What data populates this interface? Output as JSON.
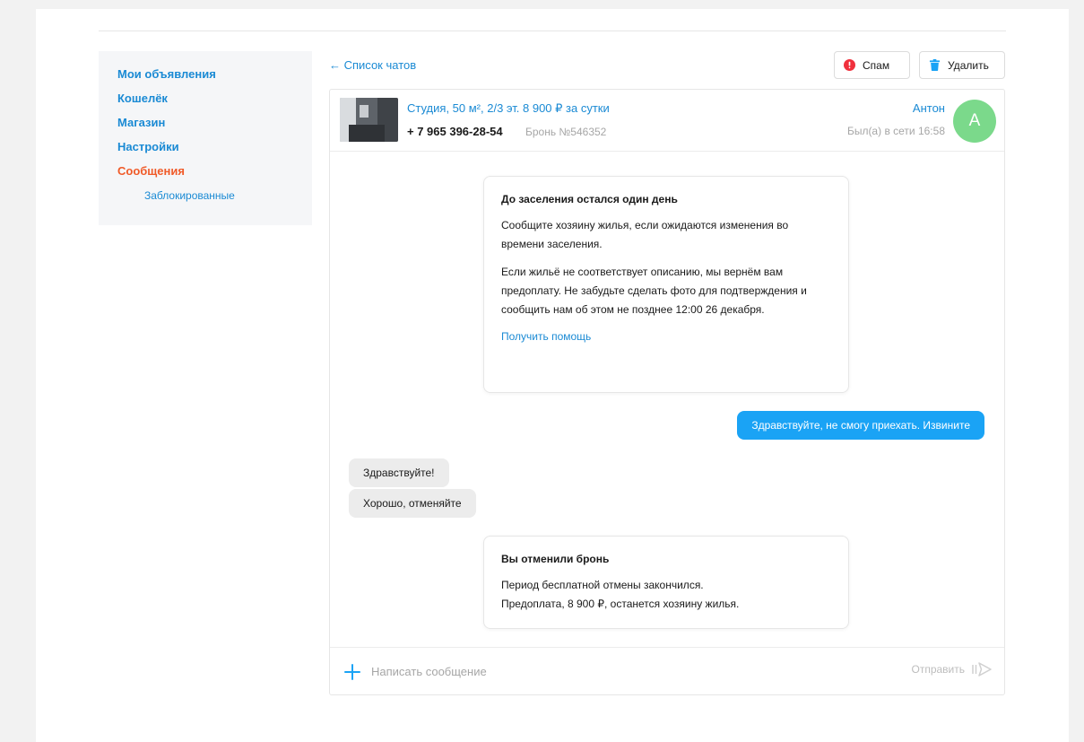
{
  "sidebar": {
    "items": [
      {
        "label": "Мои объявления"
      },
      {
        "label": "Кошелёк"
      },
      {
        "label": "Магазин"
      },
      {
        "label": "Настройки"
      },
      {
        "label": "Сообщения"
      }
    ],
    "sub_label": "Заблокированные"
  },
  "toolbar": {
    "back_label": "← Список чатов",
    "spam_label": "Спам",
    "delete_label": "Удалить"
  },
  "chat": {
    "listing_title": "Студия, 50 м², 2/3 эт.  8 900 ₽ за сутки",
    "phone": "+ 7 965 396-28-54",
    "booking": "Бронь №546352",
    "user_name": "Антон",
    "user_status": "Был(а) в сети 16:58",
    "avatar_letter": "А"
  },
  "messages": {
    "card1": {
      "title": "До заселения остался один день",
      "p1": "Сообщите хозяину жилья, если ожидаются изменения во времени заселения.",
      "p2": "Если жильё не соответствует описанию, мы вернём вам предоплату. Не забудьте сделать фото для подтверждения и сообщить нам об этом не позднее 12:00 26 декабря.",
      "help": "Получить помощь"
    },
    "outgoing": "Здравствуйте, не смогу приехать. Извините",
    "incoming": [
      "Здравствуйте!",
      "Хорошо, отменяйте"
    ],
    "card2": {
      "title": "Вы отменили бронь",
      "p1": "Период бесплатной отмены закончился.",
      "p2": "Предоплата, 8 900 ₽, останется хозяину жилья."
    }
  },
  "composer": {
    "placeholder": "Написать сообщение",
    "send_label": "Отправить"
  },
  "colors": {
    "link": "#1a8ad4",
    "active": "#f05a28",
    "accent": "#1aa3f5",
    "avatar": "#7bd98b",
    "spam_icon": "#f0303c"
  },
  "icons": {
    "spam": "alert-circle-icon",
    "delete": "trash-icon",
    "attach": "plus-icon",
    "send": "send-icon"
  }
}
